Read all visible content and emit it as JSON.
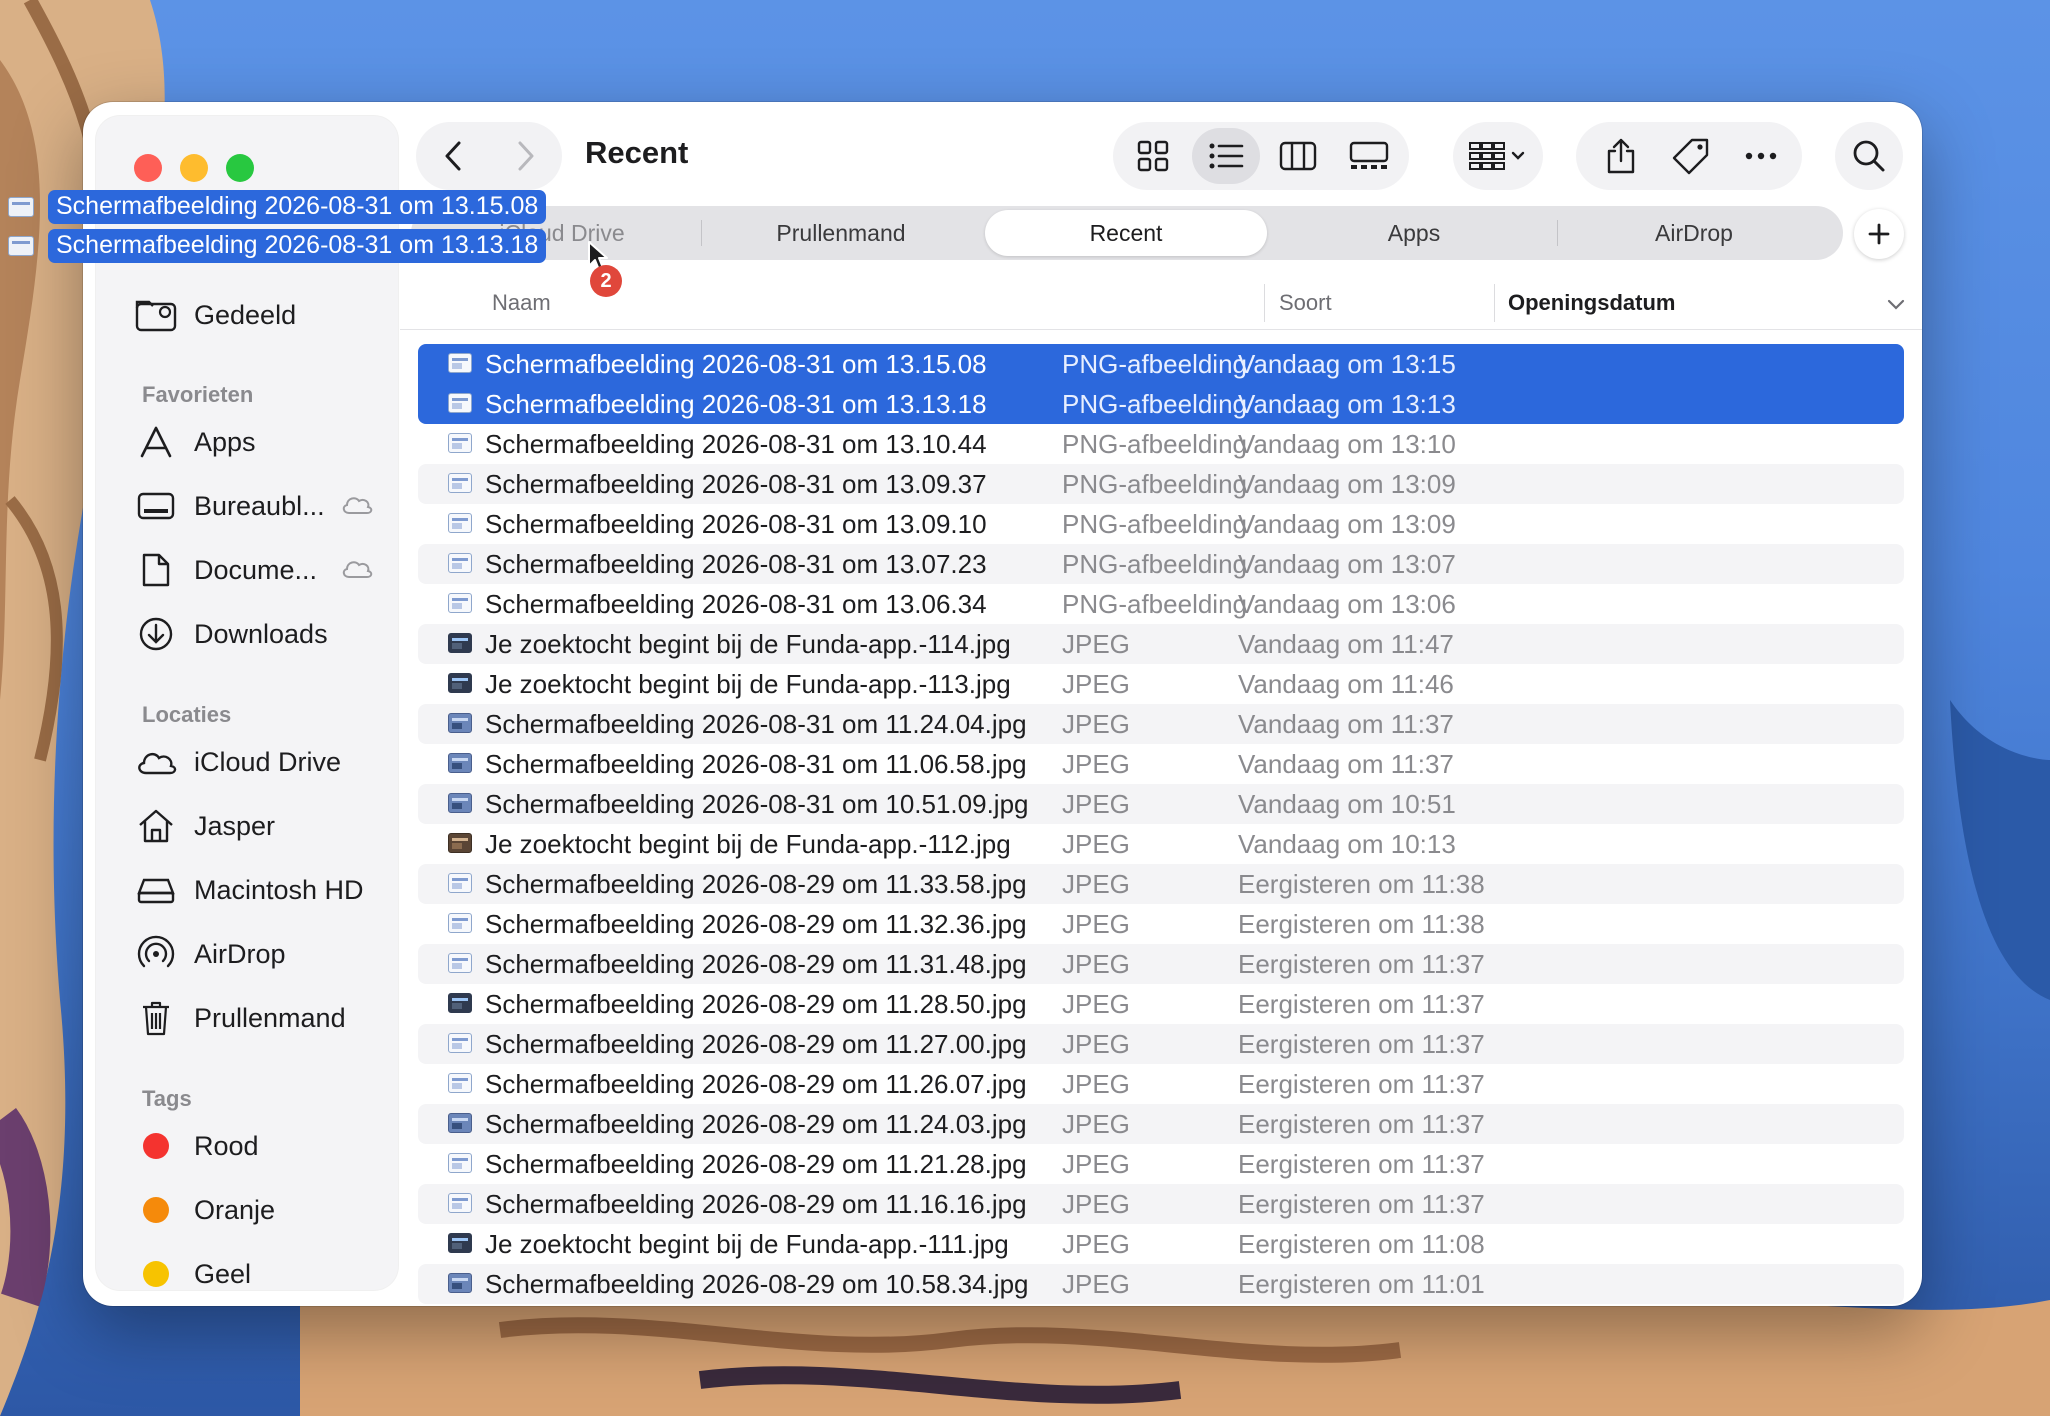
{
  "window": {
    "title": "Recent"
  },
  "sidebar": {
    "partial_top": "Gedeeld",
    "sections": {
      "favorites": "Favorieten",
      "locations": "Locaties",
      "tags": "Tags"
    },
    "favorites": [
      {
        "label": "Apps",
        "icon": "apps-icon"
      },
      {
        "label": "Bureaubl...",
        "icon": "desktop-icon",
        "cloud": true
      },
      {
        "label": "Docume...",
        "icon": "document-icon",
        "cloud": true
      },
      {
        "label": "Downloads",
        "icon": "downloads-icon"
      }
    ],
    "locations": [
      {
        "label": "iCloud Drive",
        "icon": "icloud-icon"
      },
      {
        "label": "Jasper",
        "icon": "home-icon"
      },
      {
        "label": "Macintosh HD",
        "icon": "disk-icon"
      },
      {
        "label": "AirDrop",
        "icon": "airdrop-icon"
      },
      {
        "label": "Prullenmand",
        "icon": "trash-icon"
      }
    ],
    "tags": [
      {
        "label": "Rood",
        "color": "#f4332f"
      },
      {
        "label": "Oranje",
        "color": "#f58a0b"
      },
      {
        "label": "Geel",
        "color": "#f7c300"
      }
    ]
  },
  "tabs": [
    {
      "label": "iCloud Drive",
      "active": false
    },
    {
      "label": "Prullenmand",
      "active": false
    },
    {
      "label": "Recent",
      "active": true
    },
    {
      "label": "Apps",
      "active": false
    },
    {
      "label": "AirDrop",
      "active": false
    }
  ],
  "columns": {
    "name": "Naam",
    "kind": "Soort",
    "date": "Openingsdatum"
  },
  "files": [
    {
      "name": "Schermafbeelding 2026-08-31 om 13.15.08",
      "kind": "PNG-afbeelding",
      "date": "Vandaag om 13:15",
      "selected": true,
      "thumb": "screenshot"
    },
    {
      "name": "Schermafbeelding 2026-08-31 om 13.13.18",
      "kind": "PNG-afbeelding",
      "date": "Vandaag om 13:13",
      "selected": true,
      "thumb": "screenshot"
    },
    {
      "name": "Schermafbeelding 2026-08-31 om 13.10.44",
      "kind": "PNG-afbeelding",
      "date": "Vandaag om 13:10",
      "thumb": "screenshot"
    },
    {
      "name": "Schermafbeelding 2026-08-31 om 13.09.37",
      "kind": "PNG-afbeelding",
      "date": "Vandaag om 13:09",
      "thumb": "screenshot"
    },
    {
      "name": "Schermafbeelding 2026-08-31 om 13.09.10",
      "kind": "PNG-afbeelding",
      "date": "Vandaag om 13:09",
      "thumb": "screenshot"
    },
    {
      "name": "Schermafbeelding 2026-08-31 om 13.07.23",
      "kind": "PNG-afbeelding",
      "date": "Vandaag om 13:07",
      "thumb": "screenshot"
    },
    {
      "name": "Schermafbeelding 2026-08-31 om 13.06.34",
      "kind": "PNG-afbeelding",
      "date": "Vandaag om 13:06",
      "thumb": "screenshot"
    },
    {
      "name": "Je zoektocht begint bij de Funda-app.-114.jpg",
      "kind": "JPEG",
      "date": "Vandaag om 11:47",
      "thumb": "dark"
    },
    {
      "name": "Je zoektocht begint bij de Funda-app.-113.jpg",
      "kind": "JPEG",
      "date": "Vandaag om 11:46",
      "thumb": "dark"
    },
    {
      "name": "Schermafbeelding 2026-08-31 om 11.24.04.jpg",
      "kind": "JPEG",
      "date": "Vandaag om 11:37",
      "thumb": "photo"
    },
    {
      "name": "Schermafbeelding 2026-08-31 om 11.06.58.jpg",
      "kind": "JPEG",
      "date": "Vandaag om 11:37",
      "thumb": "photo"
    },
    {
      "name": "Schermafbeelding 2026-08-31 om 10.51.09.jpg",
      "kind": "JPEG",
      "date": "Vandaag om 10:51",
      "thumb": "photo"
    },
    {
      "name": "Je zoektocht begint bij de Funda-app.-112.jpg",
      "kind": "JPEG",
      "date": "Vandaag om 10:13",
      "thumb": "brown"
    },
    {
      "name": "Schermafbeelding 2026-08-29 om 11.33.58.jpg",
      "kind": "JPEG",
      "date": "Eergisteren om 11:38",
      "thumb": "screenshot"
    },
    {
      "name": "Schermafbeelding 2026-08-29 om 11.32.36.jpg",
      "kind": "JPEG",
      "date": "Eergisteren om 11:38",
      "thumb": "screenshot"
    },
    {
      "name": "Schermafbeelding 2026-08-29 om 11.31.48.jpg",
      "kind": "JPEG",
      "date": "Eergisteren om 11:37",
      "thumb": "screenshot"
    },
    {
      "name": "Schermafbeelding 2026-08-29 om 11.28.50.jpg",
      "kind": "JPEG",
      "date": "Eergisteren om 11:37",
      "thumb": "dark"
    },
    {
      "name": "Schermafbeelding 2026-08-29 om 11.27.00.jpg",
      "kind": "JPEG",
      "date": "Eergisteren om 11:37",
      "thumb": "screenshot"
    },
    {
      "name": "Schermafbeelding 2026-08-29 om 11.26.07.jpg",
      "kind": "JPEG",
      "date": "Eergisteren om 11:37",
      "thumb": "screenshot"
    },
    {
      "name": "Schermafbeelding 2026-08-29 om 11.24.03.jpg",
      "kind": "JPEG",
      "date": "Eergisteren om 11:37",
      "thumb": "photo"
    },
    {
      "name": "Schermafbeelding 2026-08-29 om 11.21.28.jpg",
      "kind": "JPEG",
      "date": "Eergisteren om 11:37",
      "thumb": "screenshot"
    },
    {
      "name": "Schermafbeelding 2026-08-29 om 11.16.16.jpg",
      "kind": "JPEG",
      "date": "Eergisteren om 11:37",
      "thumb": "screenshot"
    },
    {
      "name": "Je zoektocht begint bij de Funda-app.-111.jpg",
      "kind": "JPEG",
      "date": "Eergisteren om 11:08",
      "thumb": "dark"
    },
    {
      "name": "Schermafbeelding 2026-08-29 om 10.58.34.jpg",
      "kind": "JPEG",
      "date": "Eergisteren om 11:01",
      "thumb": "photo"
    }
  ],
  "drag": {
    "items": [
      "Schermafbeelding 2026-08-31 om 13.15.08",
      "Schermafbeelding 2026-08-31 om 13.13.18"
    ],
    "count": "2"
  },
  "colors": {
    "selection": "#2c68dc",
    "badge": "#e0473b"
  }
}
